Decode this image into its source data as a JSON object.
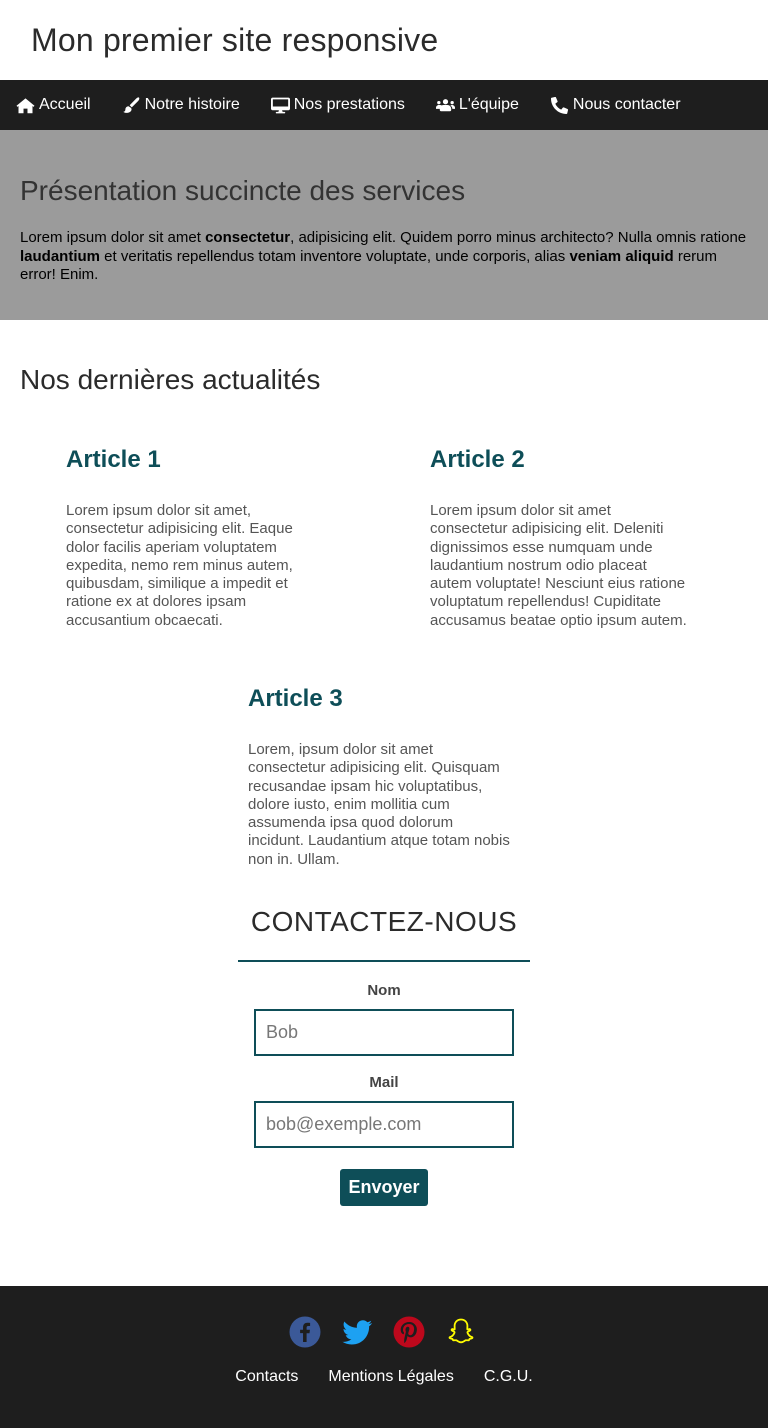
{
  "header": {
    "title": "Mon premier site responsive"
  },
  "nav": {
    "items": [
      {
        "label": "Accueil",
        "icon": "home-icon"
      },
      {
        "label": "Notre histoire",
        "icon": "brush-icon"
      },
      {
        "label": "Nos prestations",
        "icon": "desktop-icon"
      },
      {
        "label": "L'équipe",
        "icon": "users-icon"
      },
      {
        "label": "Nous contacter",
        "icon": "phone-icon"
      }
    ]
  },
  "services": {
    "title": "Présentation succincte des services",
    "text_1": "Lorem ipsum dolor sit amet ",
    "bold_1": "consectetur",
    "text_2": ", adipisicing elit. Quidem porro minus architecto? Nulla omnis ratione ",
    "bold_2": "laudantium",
    "text_3": " et veritatis repellendus totam inventore voluptate, unde corporis, alias ",
    "bold_3": "veniam aliquid",
    "text_4": " rerum error! Enim."
  },
  "news": {
    "title": "Nos dernières actualités",
    "articles": [
      {
        "title": "Article 1",
        "body": "Lorem ipsum dolor sit amet, consectetur adipisicing elit. Eaque dolor facilis aperiam voluptatem expedita, nemo rem minus autem, quibusdam, similique a impedit et ratione ex at dolores ipsam accusantium obcaecati."
      },
      {
        "title": "Article 2",
        "body": "Lorem ipsum dolor sit amet consectetur adipisicing elit. Deleniti dignissimos esse numquam unde laudantium nostrum odio placeat autem voluptate! Nesciunt eius ratione voluptatum repellendus! Cupiditate accusamus beatae optio ipsum autem."
      },
      {
        "title": "Article 3",
        "body": "Lorem, ipsum dolor sit amet consectetur adipisicing elit. Quisquam recusandae ipsam hic voluptatibus, dolore iusto, enim mollitia cum assumenda ipsa quod dolorum incidunt. Laudantium atque totam nobis non in. Ullam."
      }
    ]
  },
  "contact": {
    "title": "CONTACTEZ-NOUS",
    "name_label": "Nom",
    "name_placeholder": "Bob",
    "mail_label": "Mail",
    "mail_placeholder": "bob@exemple.com",
    "submit_label": "Envoyer"
  },
  "footer": {
    "socials": [
      {
        "icon": "facebook-icon",
        "color": "#3b5998"
      },
      {
        "icon": "twitter-icon",
        "color": "#1da1f2"
      },
      {
        "icon": "pinterest-icon",
        "color": "#bd081c"
      },
      {
        "icon": "snapchat-icon",
        "color": "#fffc00"
      }
    ],
    "links": [
      "Contacts",
      "Mentions Légales",
      "C.G.U."
    ]
  },
  "colors": {
    "accent": "#0e4e58",
    "nav_bg": "#1e1e1e",
    "services_bg": "#9b9b9b"
  }
}
